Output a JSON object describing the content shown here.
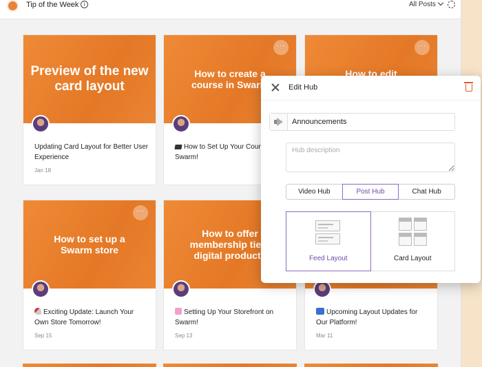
{
  "header": {
    "title": "Tip of the Week",
    "filter_label": "All Posts"
  },
  "cards": [
    {
      "banner": "Preview of the new card layout",
      "title": "Updating Card Layout for Better User Experience",
      "date": "Jan 18",
      "emoji": ""
    },
    {
      "banner": "How to create a course in Swarm",
      "title": "How to Set Up Your Course in Swarm!",
      "date": "",
      "emoji": "graduation-cap-icon"
    },
    {
      "banner": "How to edit",
      "title": "",
      "date": "",
      "emoji": ""
    },
    {
      "banner": "How to set up a Swarm store",
      "title": "Exciting Update: Launch Your Own Store Tomorrow!",
      "date": "Sep 15",
      "emoji": "rocket-icon"
    },
    {
      "banner": "How to offer membership tiers digital products",
      "title": "Setting Up Your Storefront on Swarm!",
      "date": "Sep 13",
      "emoji": "shopping-bags-icon"
    },
    {
      "banner": "",
      "title": "Upcoming Layout Updates for Our Platform!",
      "date": "Mar 11",
      "emoji": "new-badge-icon"
    }
  ],
  "modal": {
    "title": "Edit Hub",
    "name_value": "Announcements",
    "description_placeholder": "Hub description",
    "hub_types": [
      "Video Hub",
      "Post Hub",
      "Chat Hub"
    ],
    "selected_hub_type": "Post Hub",
    "layouts": [
      "Feed Layout",
      "Card Layout"
    ],
    "selected_layout": "Feed Layout"
  },
  "colors": {
    "brand_orange": "#e8823a",
    "accent_purple": "#6a4ca8",
    "delete_red": "#e25a2a"
  }
}
